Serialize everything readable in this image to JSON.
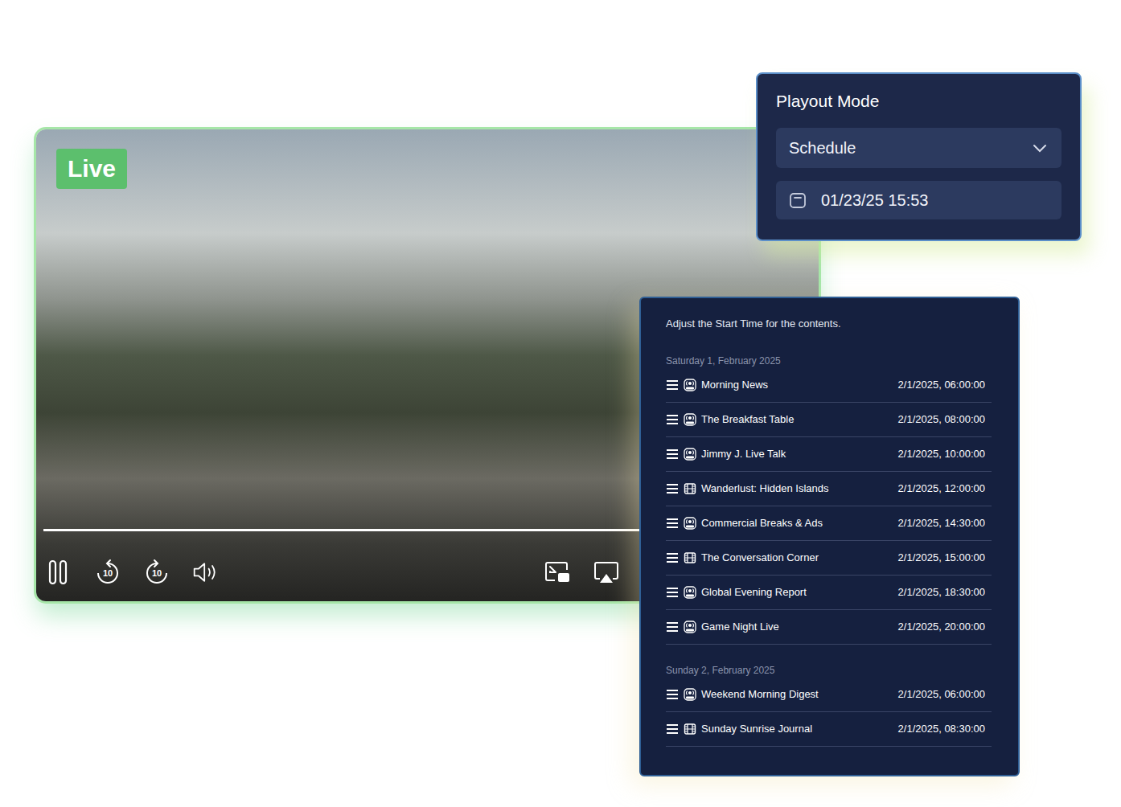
{
  "player": {
    "badge": "Live",
    "playing": true,
    "level": 1,
    "skip_back": "10",
    "skip_forward": "10"
  },
  "playout": {
    "title": "Playout Mode",
    "mode": "Schedule",
    "datetime": "01/23/25 15:53"
  },
  "schedule": {
    "instruction": "Adjust the Start Time for the contents.",
    "days": [
      {
        "label": "Saturday 1, February 2025",
        "items": [
          {
            "title": "Morning News",
            "time": "2/1/2025, 06:00:00",
            "kind": "live"
          },
          {
            "title": "The Breakfast Table",
            "time": "2/1/2025, 08:00:00",
            "kind": "live"
          },
          {
            "title": "Jimmy J. Live Talk",
            "time": "2/1/2025, 10:00:00",
            "kind": "live"
          },
          {
            "title": "Wanderlust: Hidden Islands",
            "time": "2/1/2025, 12:00:00",
            "kind": "film"
          },
          {
            "title": "Commercial Breaks & Ads",
            "time": "2/1/2025, 14:30:00",
            "kind": "live"
          },
          {
            "title": "The Conversation Corner",
            "time": "2/1/2025, 15:00:00",
            "kind": "film"
          },
          {
            "title": "Global Evening Report",
            "time": "2/1/2025, 18:30:00",
            "kind": "live"
          },
          {
            "title": "Game Night Live",
            "time": "2/1/2025, 20:00:00",
            "kind": "live"
          }
        ]
      },
      {
        "label": "Sunday 2, February 2025",
        "items": [
          {
            "title": "Weekend Morning Digest",
            "time": "2/1/2025, 06:00:00",
            "kind": "live"
          },
          {
            "title": "Sunday Sunrise Journal",
            "time": "2/1/2025, 08:30:00",
            "kind": "film"
          }
        ]
      }
    ]
  }
}
